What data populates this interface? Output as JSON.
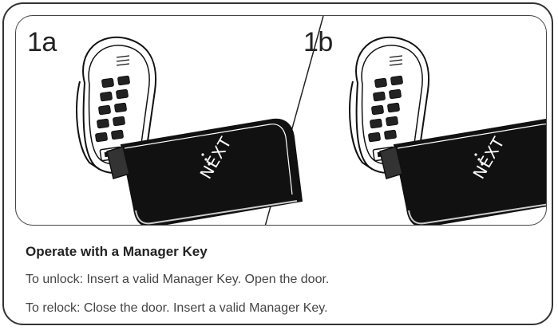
{
  "illustration": {
    "left_step": "1a",
    "right_step": "1b",
    "device_brand": "NEXT",
    "icons": [
      "keypad-lock-icon",
      "manager-key-icon"
    ]
  },
  "instructions": {
    "heading": "Operate with a Manager Key",
    "unlock": "To unlock: Insert a valid Manager Key. Open the door.",
    "relock": "To relock: Close the door. Insert a valid Manager Key."
  },
  "colors": {
    "border": "#333333",
    "text": "#444444",
    "key_body": "#111111"
  }
}
